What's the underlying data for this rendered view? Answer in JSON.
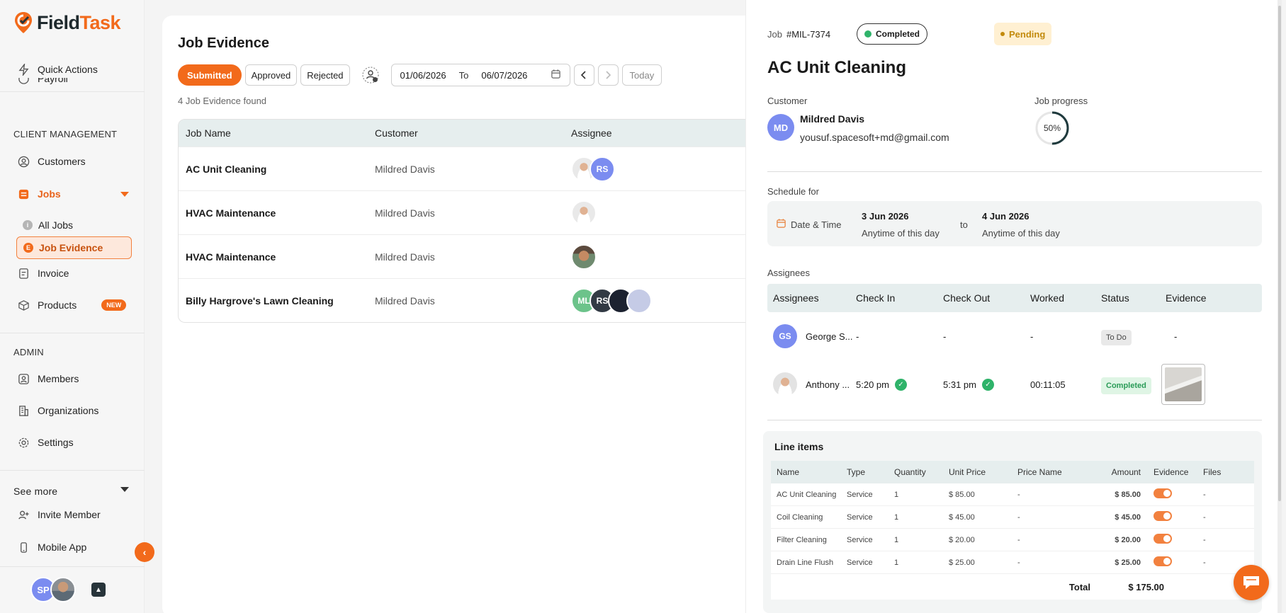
{
  "brand": {
    "name_a": "Field",
    "name_b": "Task",
    "accent": "#f26a1b"
  },
  "sidebar": {
    "quick_actions": "Quick Actions",
    "payroll": "Payroll",
    "client_management_label": "CLIENT MANAGEMENT",
    "customers": "Customers",
    "jobs": "Jobs",
    "all_jobs": "All Jobs",
    "job_evidence": "Job Evidence",
    "invoice": "Invoice",
    "products": "Products",
    "products_badge": "NEW",
    "admin_label": "ADMIN",
    "members": "Members",
    "organizations": "Organizations",
    "settings": "Settings",
    "see_more": "See more",
    "invite_member": "Invite Member",
    "mobile_app": "Mobile App",
    "user_initials": "SP"
  },
  "main": {
    "title": "Job Evidence",
    "filters": {
      "submitted": "Submitted",
      "approved": "Approved",
      "rejected": "Rejected"
    },
    "date_from": "01/06/2026",
    "date_to_label": "To",
    "date_to": "06/07/2026",
    "today": "Today",
    "count_text": "4 Job Evidence found",
    "table": {
      "headers": {
        "job_name": "Job Name",
        "customer": "Customer",
        "assignee": "Assignee"
      },
      "rows": [
        {
          "job": "AC Unit Cleaning",
          "customer": "Mildred Davis",
          "assignee_initials": "RS"
        },
        {
          "job": "HVAC Maintenance",
          "customer": "Mildred Davis"
        },
        {
          "job": "HVAC Maintenance",
          "customer": "Mildred Davis"
        },
        {
          "job": "Billy Hargrove's Lawn Cleaning",
          "customer": "Mildred Davis",
          "assignee_initials_1": "ML",
          "assignee_initials_2": "RS"
        }
      ]
    }
  },
  "detail": {
    "job_label": "Job",
    "job_id": "#MIL-7374",
    "status": "Completed",
    "approval": "Pending",
    "title": "AC Unit Cleaning",
    "customer_label": "Customer",
    "customer_initials": "MD",
    "customer_name": "Mildred Davis",
    "customer_email": "yousuf.spacesoft+md@gmail.com",
    "progress_label": "Job progress",
    "progress_value": 0.5,
    "progress_text": "50%",
    "schedule_label": "Schedule for",
    "schedule_field": "Date & Time",
    "start_date": "3 Jun 2026",
    "start_sub": "Anytime of this day",
    "to": "to",
    "end_date": "4 Jun 2026",
    "end_sub": "Anytime of this day",
    "assignees_label": "Assignees",
    "assignees": {
      "headers": {
        "assignees": "Assignees",
        "check_in": "Check In",
        "check_out": "Check Out",
        "worked": "Worked",
        "status": "Status",
        "evidence": "Evidence"
      },
      "rows": [
        {
          "initials": "GS",
          "name": "George S...",
          "check_in": "-",
          "check_out": "-",
          "worked": "-",
          "status": "To Do",
          "evidence": "-"
        },
        {
          "name": "Anthony ...",
          "check_in": "5:20 pm",
          "check_out": "5:31 pm",
          "worked": "00:11:05",
          "status": "Completed"
        }
      ]
    },
    "line_items": {
      "title": "Line items",
      "headers": {
        "name": "Name",
        "type": "Type",
        "quantity": "Quantity",
        "unit_price": "Unit Price",
        "price_name": "Price Name",
        "amount": "Amount",
        "evidence": "Evidence",
        "files": "Files"
      },
      "rows": [
        {
          "name": "AC Unit Cleaning",
          "type": "Service",
          "qty": "1",
          "unit_price": "$ 85.00",
          "price_name": "-",
          "amount": "$ 85.00",
          "files": "-"
        },
        {
          "name": "Coil Cleaning",
          "type": "Service",
          "qty": "1",
          "unit_price": "$ 45.00",
          "price_name": "-",
          "amount": "$ 45.00",
          "files": "-"
        },
        {
          "name": "Filter Cleaning",
          "type": "Service",
          "qty": "1",
          "unit_price": "$ 20.00",
          "price_name": "-",
          "amount": "$ 20.00",
          "files": "-"
        },
        {
          "name": "Drain Line Flush",
          "type": "Service",
          "qty": "1",
          "unit_price": "$ 25.00",
          "price_name": "-",
          "amount": "$ 25.00",
          "files": "-"
        }
      ],
      "total_label": "Total",
      "total_value": "$ 175.00"
    }
  }
}
